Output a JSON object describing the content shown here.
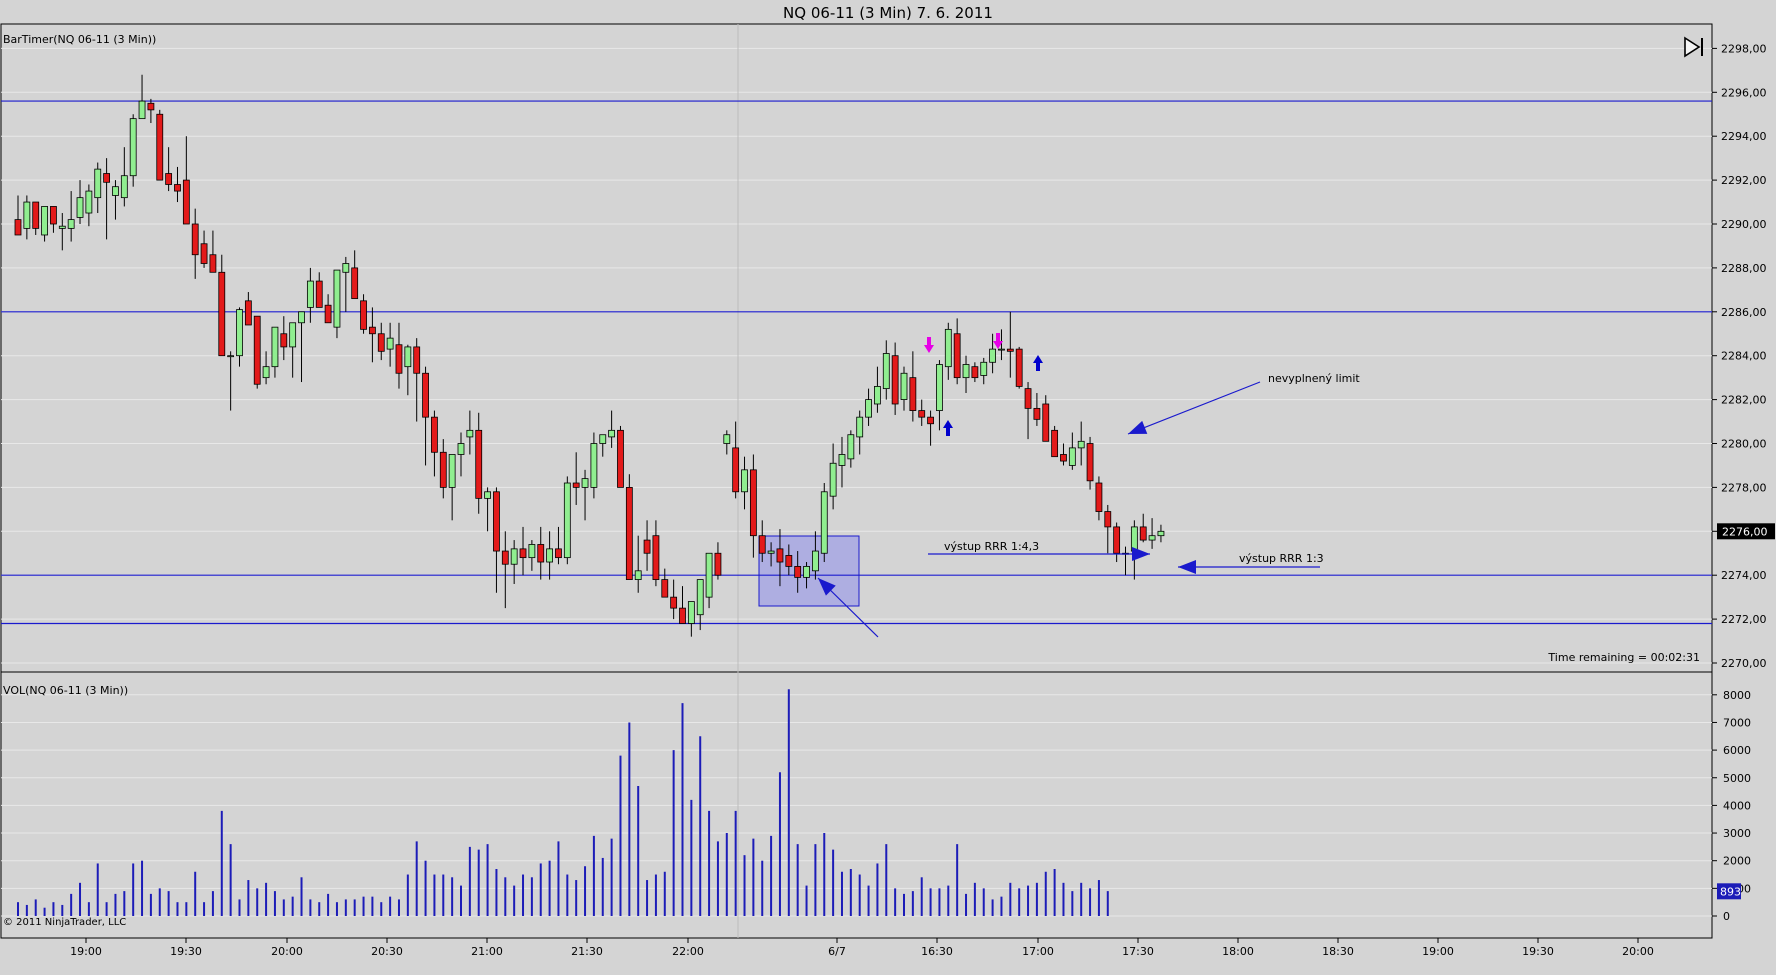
{
  "title": "NQ 06-11 (3 Min)  7. 6. 2011",
  "price_pane_label": "BarTimer(NQ 06-11 (3 Min))",
  "volume_pane_label": "VOL(NQ 06-11 (3 Min))",
  "time_remaining": "Time remaining = 00:02:31",
  "copyright": "© 2011 NinjaTrader, LLC",
  "current_price_label": "2276,00",
  "current_volume_label": "893",
  "annotations": {
    "limit": "nevyplnený limit",
    "exit1": "výstup RRR 1:4,3",
    "exit2": "výstup RRR 1:3"
  },
  "icons": {
    "skip": "skip-to-end-icon"
  },
  "colors": {
    "up_candle": "#90ee90",
    "down_candle": "#e31a1a",
    "volume_bar": "#1c1cb8",
    "hline": "#1a1acd",
    "background": "#d4d4d4"
  },
  "chart_data": [
    {
      "type": "candlestick",
      "title": "NQ 06-11 (3 Min)  7. 6. 2011",
      "y_ticks": [
        "2270,00",
        "2272,00",
        "2274,00",
        "2276,00",
        "2278,00",
        "2280,00",
        "2282,00",
        "2284,00",
        "2286,00",
        "2288,00",
        "2290,00",
        "2292,00",
        "2294,00",
        "2296,00",
        "2298,00"
      ],
      "ylim": [
        2269.5,
        2298.3
      ],
      "x_ticks": [
        "19:00",
        "19:30",
        "20:00",
        "20:30",
        "21:00",
        "21:30",
        "22:00",
        "6/7",
        "16:30",
        "17:00",
        "17:30",
        "18:00",
        "18:30",
        "19:00",
        "19:30",
        "20:00"
      ],
      "horizontal_lines": [
        2295.6,
        2286.0,
        2274.0,
        2271.8
      ],
      "current_price": 2276.0,
      "candles": [
        [
          2290.2,
          2291.3,
          2289.5,
          2289.5
        ],
        [
          2289.8,
          2291.3,
          2289.3,
          2291.0
        ],
        [
          2291.0,
          2291.0,
          2289.5,
          2289.8
        ],
        [
          2289.5,
          2290.7,
          2289.2,
          2290.8
        ],
        [
          2290.8,
          2290.8,
          2289.6,
          2290.0
        ],
        [
          2289.8,
          2290.5,
          2288.8,
          2289.9
        ],
        [
          2289.8,
          2291.5,
          2289.2,
          2290.2
        ],
        [
          2290.3,
          2292.0,
          2290.0,
          2291.2
        ],
        [
          2290.5,
          2291.8,
          2289.9,
          2291.5
        ],
        [
          2291.2,
          2292.8,
          2290.5,
          2292.5
        ],
        [
          2292.3,
          2293.0,
          2289.3,
          2291.9
        ],
        [
          2291.3,
          2292.0,
          2290.2,
          2291.7
        ],
        [
          2291.2,
          2293.5,
          2290.8,
          2292.2
        ],
        [
          2292.2,
          2295.0,
          2291.7,
          2294.8
        ],
        [
          2294.8,
          2296.8,
          2294.8,
          2295.6
        ],
        [
          2295.5,
          2295.7,
          2294.6,
          2295.2
        ],
        [
          2295.0,
          2295.2,
          2292.0,
          2292.0
        ],
        [
          2292.3,
          2293.5,
          2291.5,
          2291.8
        ],
        [
          2291.8,
          2292.6,
          2291.0,
          2291.5
        ],
        [
          2292.0,
          2294.0,
          2291.0,
          2290.0
        ],
        [
          2290.0,
          2290.7,
          2287.5,
          2288.6
        ],
        [
          2289.1,
          2289.7,
          2288.0,
          2288.2
        ],
        [
          2288.6,
          2289.7,
          2288.0,
          2287.8
        ],
        [
          2287.8,
          2288.6,
          2286.0,
          2284.0
        ],
        [
          2284.0,
          2284.2,
          2281.5,
          2284.0
        ],
        [
          2284.0,
          2286.2,
          2283.5,
          2286.1
        ],
        [
          2286.5,
          2286.9,
          2285.6,
          2285.4
        ],
        [
          2285.8,
          2285.8,
          2282.5,
          2282.7
        ],
        [
          2283.0,
          2284.2,
          2282.7,
          2283.5
        ],
        [
          2283.5,
          2285.2,
          2283.0,
          2285.3
        ],
        [
          2285.0,
          2285.8,
          2283.8,
          2284.4
        ],
        [
          2284.4,
          2285.5,
          2283.0,
          2285.5
        ],
        [
          2285.5,
          2286.0,
          2282.8,
          2286.0
        ],
        [
          2286.2,
          2288.0,
          2285.5,
          2287.4
        ],
        [
          2287.4,
          2287.8,
          2286.4,
          2286.2
        ],
        [
          2286.3,
          2286.8,
          2285.5,
          2285.5
        ],
        [
          2285.3,
          2286.0,
          2284.8,
          2287.9
        ],
        [
          2287.8,
          2288.5,
          2286.0,
          2288.2
        ],
        [
          2288.0,
          2288.8,
          2287.2,
          2286.6
        ],
        [
          2286.5,
          2286.8,
          2285.0,
          2285.2
        ],
        [
          2285.3,
          2286.2,
          2283.7,
          2285.0
        ],
        [
          2285.0,
          2285.5,
          2283.8,
          2284.2
        ],
        [
          2284.3,
          2285.5,
          2283.5,
          2284.8
        ],
        [
          2284.5,
          2285.5,
          2282.5,
          2283.2
        ],
        [
          2283.5,
          2284.5,
          2282.2,
          2284.4
        ],
        [
          2284.4,
          2284.8,
          2281.0,
          2283.2
        ],
        [
          2283.2,
          2283.5,
          2279.0,
          2281.2
        ],
        [
          2281.2,
          2281.5,
          2278.5,
          2279.6
        ],
        [
          2279.6,
          2280.2,
          2277.5,
          2278.0
        ],
        [
          2278.0,
          2279.5,
          2276.5,
          2279.5
        ],
        [
          2279.5,
          2280.5,
          2278.5,
          2280.0
        ],
        [
          2280.3,
          2281.5,
          2279.5,
          2280.6
        ],
        [
          2280.6,
          2281.4,
          2276.8,
          2277.5
        ],
        [
          2277.5,
          2278.0,
          2276.0,
          2277.8
        ],
        [
          2277.8,
          2278.0,
          2273.2,
          2275.1
        ],
        [
          2275.1,
          2276.0,
          2272.5,
          2274.5
        ],
        [
          2274.5,
          2275.6,
          2273.6,
          2275.2
        ],
        [
          2275.2,
          2276.2,
          2274.0,
          2274.8
        ],
        [
          2274.8,
          2275.6,
          2274.2,
          2275.4
        ],
        [
          2275.4,
          2276.2,
          2273.8,
          2274.6
        ],
        [
          2274.6,
          2276.0,
          2273.8,
          2275.2
        ],
        [
          2275.2,
          2276.2,
          2274.5,
          2274.8
        ],
        [
          2274.8,
          2278.5,
          2274.5,
          2278.2
        ],
        [
          2278.2,
          2279.6,
          2277.2,
          2278.0
        ],
        [
          2278.0,
          2278.8,
          2276.5,
          2278.4
        ],
        [
          2278.0,
          2280.5,
          2277.5,
          2280.0
        ],
        [
          2280.0,
          2280.4,
          2279.4,
          2280.4
        ],
        [
          2280.3,
          2281.5,
          2279.8,
          2280.6
        ],
        [
          2280.6,
          2280.8,
          2278.0,
          2278.0
        ],
        [
          2278.0,
          2278.6,
          2273.8,
          2273.8
        ],
        [
          2273.8,
          2275.8,
          2273.2,
          2274.2
        ],
        [
          2275.6,
          2276.5,
          2274.2,
          2275.0
        ],
        [
          2275.8,
          2276.5,
          2273.5,
          2273.8
        ],
        [
          2273.8,
          2274.3,
          2273.0,
          2273.0
        ],
        [
          2273.0,
          2273.8,
          2272.0,
          2272.5
        ],
        [
          2272.5,
          2273.5,
          2271.8,
          2271.8
        ],
        [
          2271.8,
          2272.5,
          2271.2,
          2272.8
        ],
        [
          2272.2,
          2273.6,
          2271.5,
          2273.8
        ],
        [
          2273.0,
          2275.0,
          2272.5,
          2275.0
        ],
        [
          2275.0,
          2275.5,
          2273.8,
          2274.0
        ],
        [
          2280.0,
          2280.6,
          2279.5,
          2280.4
        ],
        [
          2279.8,
          2281.0,
          2277.5,
          2277.8
        ],
        [
          2277.8,
          2279.4,
          2277.0,
          2278.8
        ],
        [
          2278.8,
          2279.5,
          2274.8,
          2275.8
        ],
        [
          2275.8,
          2276.5,
          2274.6,
          2275.0
        ],
        [
          2275.0,
          2275.5,
          2274.4,
          2275.1
        ],
        [
          2275.2,
          2276.1,
          2273.5,
          2274.6
        ],
        [
          2274.9,
          2275.4,
          2274.0,
          2274.4
        ],
        [
          2274.4,
          2275.1,
          2273.2,
          2273.9
        ],
        [
          2273.9,
          2274.6,
          2273.4,
          2274.4
        ],
        [
          2274.2,
          2276.0,
          2273.8,
          2275.1
        ],
        [
          2275.0,
          2278.2,
          2274.6,
          2277.8
        ],
        [
          2277.6,
          2280.0,
          2277.0,
          2279.1
        ],
        [
          2279.0,
          2280.3,
          2278.0,
          2279.5
        ],
        [
          2279.3,
          2280.6,
          2278.9,
          2280.4
        ],
        [
          2280.3,
          2281.5,
          2279.5,
          2281.2
        ],
        [
          2281.2,
          2282.5,
          2280.8,
          2282.0
        ],
        [
          2281.8,
          2283.5,
          2281.4,
          2282.6
        ],
        [
          2282.5,
          2284.7,
          2282.0,
          2284.1
        ],
        [
          2284.0,
          2284.6,
          2281.3,
          2281.8
        ],
        [
          2282.0,
          2283.5,
          2281.5,
          2283.2
        ],
        [
          2283.0,
          2284.2,
          2281.0,
          2281.5
        ],
        [
          2281.5,
          2282.0,
          2280.8,
          2281.2
        ],
        [
          2281.2,
          2281.5,
          2279.9,
          2280.9
        ],
        [
          2281.5,
          2283.8,
          2280.6,
          2283.6
        ],
        [
          2283.5,
          2285.5,
          2282.9,
          2285.2
        ],
        [
          2285.0,
          2285.7,
          2282.7,
          2283.0
        ],
        [
          2283.0,
          2284.0,
          2282.3,
          2283.6
        ],
        [
          2283.5,
          2283.7,
          2282.8,
          2283.0
        ],
        [
          2283.1,
          2283.9,
          2282.7,
          2283.7
        ],
        [
          2283.7,
          2285.0,
          2283.2,
          2284.3
        ],
        [
          2284.3,
          2285.2,
          2283.8,
          2284.3
        ],
        [
          2284.3,
          2286.0,
          2283.0,
          2284.2
        ],
        [
          2284.3,
          2284.4,
          2282.5,
          2282.6
        ],
        [
          2282.5,
          2282.8,
          2280.2,
          2281.6
        ],
        [
          2281.6,
          2282.3,
          2280.8,
          2281.1
        ],
        [
          2281.8,
          2282.2,
          2280.1,
          2280.1
        ],
        [
          2280.6,
          2280.8,
          2279.4,
          2279.4
        ],
        [
          2279.5,
          2280.0,
          2279.0,
          2279.2
        ],
        [
          2279.0,
          2280.5,
          2278.8,
          2279.8
        ],
        [
          2279.8,
          2281.0,
          2279.0,
          2280.1
        ],
        [
          2280.0,
          2280.3,
          2277.9,
          2278.3
        ],
        [
          2278.2,
          2278.5,
          2276.5,
          2276.9
        ],
        [
          2276.9,
          2277.2,
          2275.0,
          2276.2
        ],
        [
          2276.2,
          2276.4,
          2274.6,
          2275.0
        ],
        [
          2275.0,
          2275.3,
          2274.0,
          2275.0
        ],
        [
          2275.1,
          2276.5,
          2273.8,
          2276.2
        ],
        [
          2276.2,
          2276.8,
          2275.5,
          2275.6
        ],
        [
          2275.6,
          2276.6,
          2275.2,
          2275.8
        ],
        [
          2275.8,
          2276.3,
          2275.5,
          2276.0
        ]
      ],
      "annotations": [
        "nevyplnený limit",
        "výstup RRR 1:4,3",
        "výstup RRR 1:3",
        "Time remaining = 00:02:31"
      ]
    },
    {
      "type": "bar",
      "title": "VOL(NQ 06-11 (3 Min))",
      "y_ticks": [
        "0",
        "1000",
        "2000",
        "3000",
        "4000",
        "5000",
        "6000",
        "7000",
        "8000"
      ],
      "ylim": [
        0,
        8200
      ],
      "current_value": 893,
      "values": [
        500,
        400,
        600,
        300,
        500,
        400,
        800,
        1200,
        500,
        1900,
        500,
        800,
        900,
        1900,
        2000,
        800,
        1000,
        900,
        500,
        500,
        1600,
        500,
        900,
        3800,
        2600,
        600,
        1300,
        1000,
        1200,
        900,
        600,
        700,
        1400,
        600,
        500,
        800,
        500,
        600,
        600,
        700,
        700,
        500,
        700,
        600,
        1500,
        2700,
        2000,
        1500,
        1500,
        1400,
        1100,
        2500,
        2400,
        2600,
        1700,
        1400,
        1100,
        1500,
        1400,
        1900,
        2000,
        2700,
        1500,
        1300,
        1800,
        2900,
        2100,
        2800,
        5800,
        7000,
        4700,
        1300,
        1500,
        1600,
        6000,
        7700,
        4200,
        6500,
        3800,
        2700,
        3000,
        3800,
        2200,
        2800,
        2000,
        2900,
        5200,
        8200,
        2600,
        1100,
        2600,
        3000,
        2400,
        1600,
        1700,
        1500,
        1100,
        1900,
        2600,
        1000,
        800,
        900,
        1400,
        1000,
        1000,
        1100,
        2600,
        800,
        1200,
        1000,
        600,
        700,
        1200,
        1000,
        1100,
        1200,
        1600,
        1700,
        1200,
        900,
        1200,
        1000,
        1300,
        900
      ]
    }
  ]
}
